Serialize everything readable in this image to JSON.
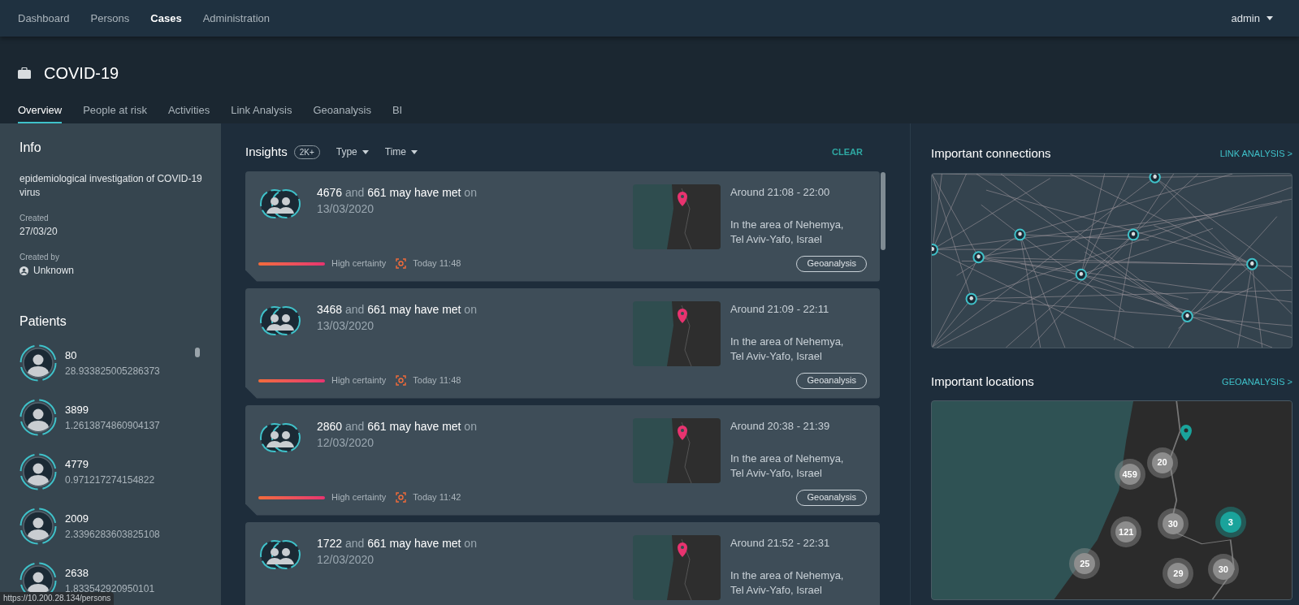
{
  "top_nav": {
    "items": [
      {
        "label": "Dashboard",
        "selected": false
      },
      {
        "label": "Persons",
        "selected": false
      },
      {
        "label": "Cases",
        "selected": true
      },
      {
        "label": "Administration",
        "selected": false
      }
    ],
    "user": "admin"
  },
  "case": {
    "title": "COVID-19",
    "tabs": [
      {
        "label": "Overview",
        "selected": true
      },
      {
        "label": "People at risk",
        "selected": false
      },
      {
        "label": "Activities",
        "selected": false
      },
      {
        "label": "Link Analysis",
        "selected": false
      },
      {
        "label": "Geoanalysis",
        "selected": false
      },
      {
        "label": "BI",
        "selected": false
      }
    ]
  },
  "info": {
    "title": "Info",
    "description": "epidemiological investigation of COVID-19 virus",
    "fields": [
      {
        "label": "Created",
        "value": "27/03/20",
        "kind": "text"
      },
      {
        "label": "Created by",
        "value": "Unknown",
        "kind": "user"
      }
    ]
  },
  "patients": {
    "title": "Patients",
    "items": [
      {
        "id": "80",
        "score": "28.933825005286373"
      },
      {
        "id": "3899",
        "score": "1.2613874860904137"
      },
      {
        "id": "4779",
        "score": "0.971217274154822"
      },
      {
        "id": "2009",
        "score": "2.3396283603825108"
      },
      {
        "id": "2638",
        "score": "1.833542920950101"
      }
    ]
  },
  "insights": {
    "title": "Insights",
    "count": "2K+",
    "filters": [
      "Type",
      "Time"
    ],
    "clear": "CLEAR",
    "cards": [
      {
        "summary": "**4676** and **661** **may have met** on 13/03/2020",
        "time": "Around 21:08 - 22:00",
        "area": "In the area of Nehemya, Tel Aviv-Yafo, Israel",
        "certainty": "High certainty",
        "updated": "Today 11:48",
        "action": "Geoanalysis"
      },
      {
        "summary": "**3468** and **661** **may have met** on 13/03/2020",
        "time": "Around 21:09 - 22:11",
        "area": "In the area of Nehemya, Tel Aviv-Yafo, Israel",
        "certainty": "High certainty",
        "updated": "Today 11:48",
        "action": "Geoanalysis"
      },
      {
        "summary": "**2860** and **661** **may have met** on 12/03/2020",
        "time": "Around 20:38 - 21:39",
        "area": "In the area of Nehemya, Tel Aviv-Yafo, Israel",
        "certainty": "High certainty",
        "updated": "Today 11:42",
        "action": "Geoanalysis"
      },
      {
        "summary": "**1722** and **661** **may have met** on 12/03/2020",
        "time": "Around 21:52 - 22:31",
        "area": "In the area of Nehemya, Tel Aviv-Yafo, Israel"
      }
    ]
  },
  "connections": {
    "title": "Important connections",
    "link": "LINK ANALYSIS >"
  },
  "locations": {
    "title": "Important locations",
    "link": "GEOANALYSIS >",
    "clusters": [
      {
        "count": "20",
        "kind": "grey"
      },
      {
        "count": "459",
        "kind": "grey"
      },
      {
        "count": "121",
        "kind": "grey"
      },
      {
        "count": "30",
        "kind": "grey"
      },
      {
        "count": "3",
        "kind": "teal"
      },
      {
        "count": "25",
        "kind": "grey"
      },
      {
        "count": "29",
        "kind": "grey"
      },
      {
        "count": "30",
        "kind": "grey"
      }
    ]
  },
  "status_bar": {
    "url": "https://10.200.28.134/persons"
  }
}
